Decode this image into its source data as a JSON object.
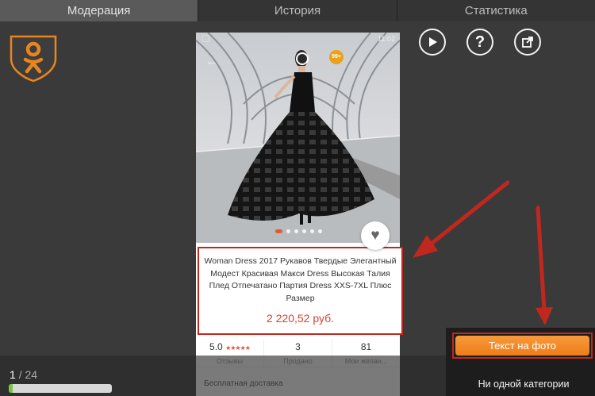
{
  "tabs": [
    {
      "label": "Модерация",
      "active": true
    },
    {
      "label": "История",
      "active": false
    },
    {
      "label": "Статистика",
      "active": false
    }
  ],
  "actions": {
    "play_icon": "play-icon",
    "help_icon": "question-icon",
    "external_icon": "external-link-icon"
  },
  "phone": {
    "status_time": "11:02",
    "badge": "99+",
    "product_title": "Woman Dress 2017 Рукавов Твердые Элегантный Модест Красивая Макси Dress Высокая Талия Плед Отпечатано Партия Dress XXS-7XL Плюс Размер",
    "price": "2 220,52 руб.",
    "rating": "5.0",
    "rating_stars": "★★★★★",
    "rating_label": "Отзывы",
    "sold": "3",
    "sold_label": "Продано",
    "wishlist": "81",
    "wishlist_label": "Мои желан...",
    "delivery": "Бесплатная доставка"
  },
  "counter": {
    "current": "1",
    "total": "/ 24"
  },
  "progress": {
    "fraction": 0.04
  },
  "categories": {
    "text_on_photo": "Текст на фото",
    "none": "Ни одной категории"
  },
  "colors": {
    "accent_orange": "#ee7d19",
    "highlight_red": "#c0281f",
    "progress_green": "#78c446"
  }
}
